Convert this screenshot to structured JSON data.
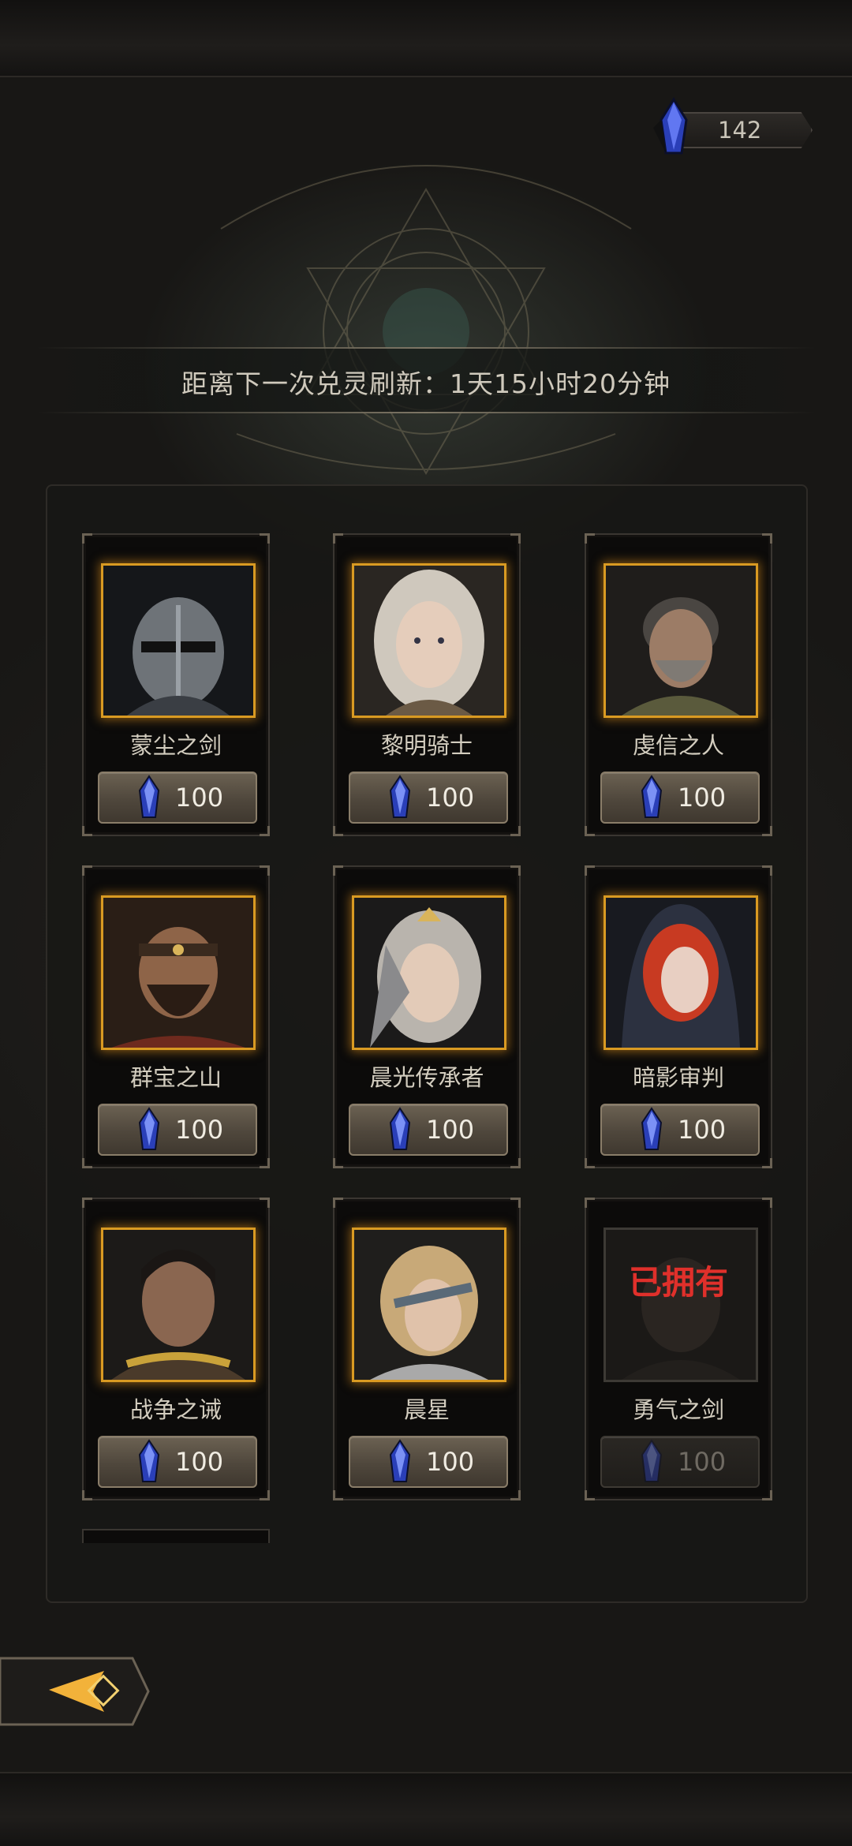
{
  "currency": {
    "icon": "blue-crystal-icon",
    "amount": "142"
  },
  "refresh": {
    "text": "距离下一次兑灵刷新：1天15小时20分钟"
  },
  "heroes": [
    {
      "name": "蒙尘之剑",
      "price": "100",
      "owned": false,
      "portrait": "helmeted-knight"
    },
    {
      "name": "黎明骑士",
      "price": "100",
      "owned": false,
      "portrait": "silver-haired-woman"
    },
    {
      "name": "虔信之人",
      "price": "100",
      "owned": false,
      "portrait": "gray-bearded-man"
    },
    {
      "name": "群宝之山",
      "price": "100",
      "owned": false,
      "portrait": "bearded-headband-man"
    },
    {
      "name": "晨光传承者",
      "price": "100",
      "owned": false,
      "portrait": "silver-haired-crowned-warrior"
    },
    {
      "name": "暗影审判",
      "price": "100",
      "owned": false,
      "portrait": "red-haired-hooded-woman"
    },
    {
      "name": "战争之诫",
      "price": "100",
      "owned": false,
      "portrait": "dark-haired-warrior"
    },
    {
      "name": "晨星",
      "price": "100",
      "owned": false,
      "portrait": "blonde-bandana-hero"
    },
    {
      "name": "勇气之剑",
      "price": "100",
      "owned": true,
      "owned_label": "已拥有",
      "portrait": "faded-portrait"
    }
  ],
  "colors": {
    "frame_gold": "#d99a22",
    "owned_red": "#e0302b",
    "crystal_blue": "#3d5be0"
  },
  "back_button": {
    "icon": "back-arrow-icon"
  }
}
